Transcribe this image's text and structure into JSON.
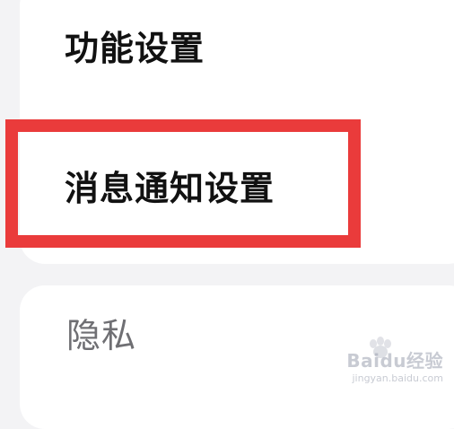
{
  "settings": {
    "items": [
      {
        "label": "功能设置"
      },
      {
        "label": "消息通知设置"
      },
      {
        "label": "隐私"
      }
    ]
  },
  "annotation": {
    "highlight_color": "#ea3b3b"
  },
  "watermark": {
    "text": "Baidu经验",
    "subtext": "jingyan.baidu.com"
  }
}
